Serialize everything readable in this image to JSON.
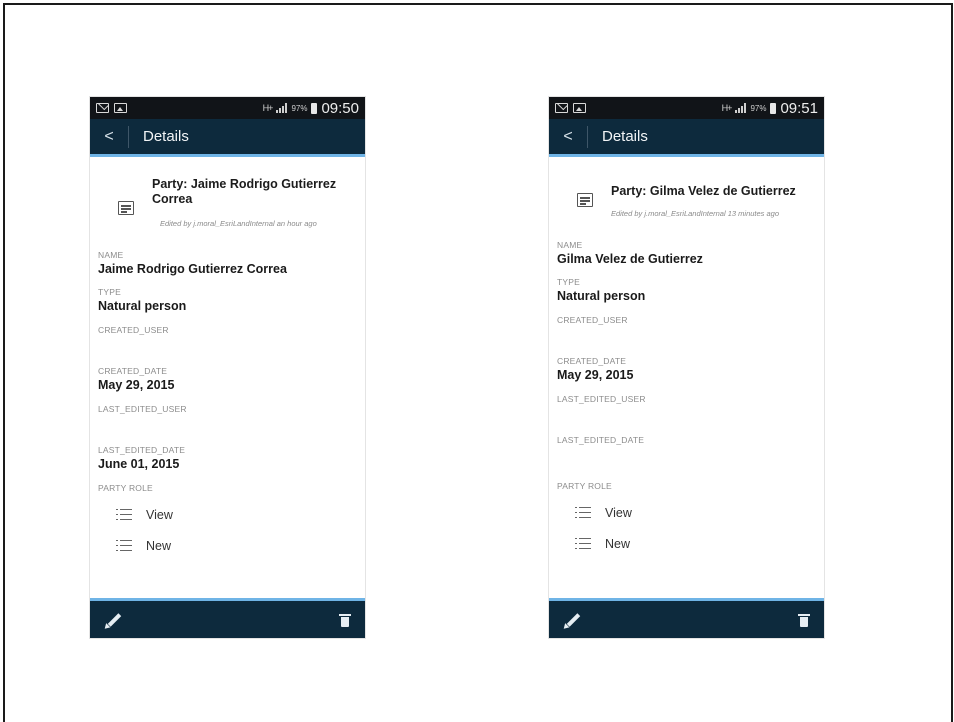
{
  "screens": [
    {
      "status": {
        "battery": "97%",
        "time": "09:50",
        "network": "H+"
      },
      "appbar": {
        "back_label": "<",
        "title": "Details"
      },
      "header": {
        "title": "Party: Jaime Rodrigo Gutierrez Correa",
        "edited_by": "Edited by j.moral_EsriLandInternal an hour ago"
      },
      "fields": {
        "name_label": "NAME",
        "name_value": "Jaime Rodrigo Gutierrez Correa",
        "type_label": "TYPE",
        "type_value": "Natural person",
        "created_user_label": "CREATED_USER",
        "created_user_value": "",
        "created_date_label": "CREATED_DATE",
        "created_date_value": "May 29, 2015",
        "last_edited_user_label": "LAST_EDITED_USER",
        "last_edited_user_value": "",
        "last_edited_date_label": "LAST_EDITED_DATE",
        "last_edited_date_value": "June 01, 2015",
        "party_role_label": "PARTY ROLE"
      },
      "party_role_items": [
        "View",
        "New"
      ]
    },
    {
      "status": {
        "battery": "97%",
        "time": "09:51",
        "network": "H+"
      },
      "appbar": {
        "back_label": "<",
        "title": "Details"
      },
      "header": {
        "title": "Party: Gilma Velez de Gutierrez",
        "edited_by": "Edited by j.moral_EsriLandInternal 13 minutes ago"
      },
      "fields": {
        "name_label": "NAME",
        "name_value": "Gilma Velez de Gutierrez",
        "type_label": "TYPE",
        "type_value": "Natural person",
        "created_user_label": "CREATED_USER",
        "created_user_value": "",
        "created_date_label": "CREATED_DATE",
        "created_date_value": "May 29, 2015",
        "last_edited_user_label": "LAST_EDITED_USER",
        "last_edited_user_value": "",
        "last_edited_date_label": "LAST_EDITED_DATE",
        "last_edited_date_value": "",
        "party_role_label": "PARTY ROLE"
      },
      "party_role_items": [
        "View",
        "New"
      ]
    }
  ]
}
